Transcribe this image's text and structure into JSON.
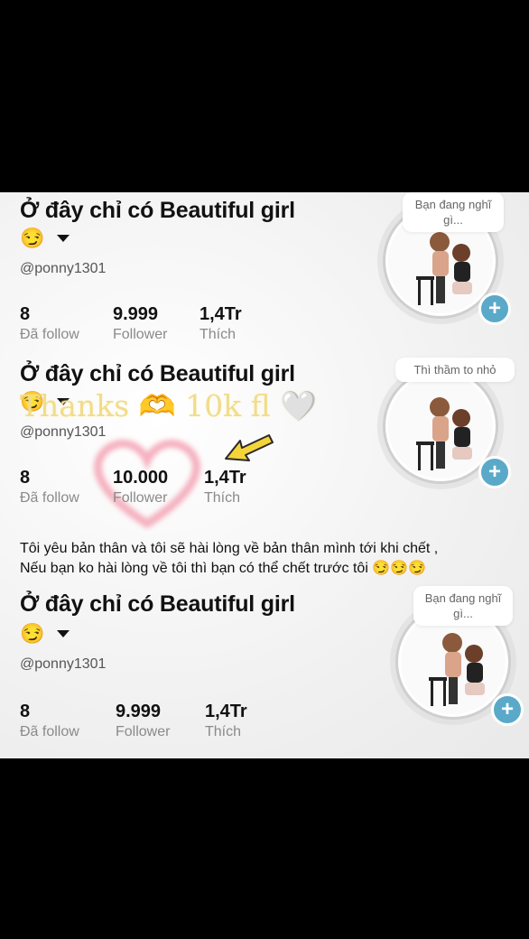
{
  "profiles": [
    {
      "title": "Ở đây chỉ có Beautiful girl",
      "emoji": "😏",
      "handle": "@ponny1301",
      "bubble": "Bạn đang nghĩ gì...",
      "stats": [
        {
          "num": "8",
          "label": "Đã follow"
        },
        {
          "num": "9.999",
          "label": "Follower"
        },
        {
          "num": "1,4Tr",
          "label": "Thích"
        }
      ]
    },
    {
      "title": "Ở đây chỉ có Beautiful girl",
      "emoji": "😏",
      "handle": "@ponny1301",
      "bubble": "Thì thầm to nhỏ",
      "stats": [
        {
          "num": "8",
          "label": "Đã follow"
        },
        {
          "num": "10.000",
          "label": "Follower"
        },
        {
          "num": "1,4Tr",
          "label": "Thích"
        }
      ]
    },
    {
      "title": "Ở đây chỉ có Beautiful girl",
      "emoji": "😏",
      "handle": "@ponny1301",
      "bubble": "Bạn đang nghĩ gì...",
      "stats": [
        {
          "num": "8",
          "label": "Đã follow"
        },
        {
          "num": "9.999",
          "label": "Follower"
        },
        {
          "num": "1,4Tr",
          "label": "Thích"
        }
      ]
    }
  ],
  "overlay": "Thanks 🫶 10k fl 🤍",
  "bio_line1": "Tôi yêu bản thân và tôi sẽ hài lòng về bản thân mình tới khi chết ,",
  "bio_line2": "Nếu bạn ko hài lòng về tôi thì bạn có thể chết trước tôi 😏😏😏",
  "plus_symbol": "+",
  "colors": {
    "accent": "#5aa9c9",
    "heart": "#f4a3b4",
    "arrow": "#f5d43a"
  }
}
